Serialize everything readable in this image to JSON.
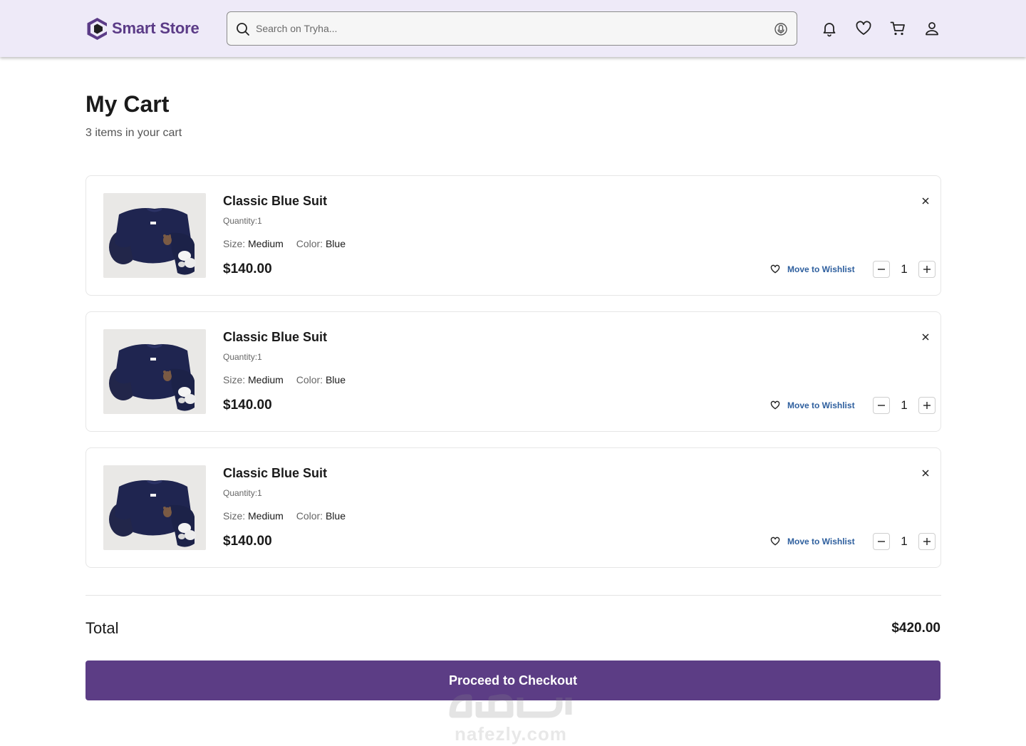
{
  "header": {
    "brand": "Smart Store",
    "search": {
      "placeholder": "Search on Tryha..."
    },
    "icons": [
      "bell-icon",
      "heart-icon",
      "cart-icon",
      "user-icon"
    ]
  },
  "page": {
    "title": "My Cart",
    "subtitle": "3 items in your cart"
  },
  "labels": {
    "size": "Size:",
    "color": "Color:",
    "move_to_wishlist": "Move to Wishlist"
  },
  "cart": {
    "items": [
      {
        "name": "Classic Blue Suit",
        "quantity_text": "Quantity:1",
        "size": "Medium",
        "color": "Blue",
        "price": "$140.00",
        "qty": "1"
      },
      {
        "name": "Classic Blue Suit",
        "quantity_text": "Quantity:1",
        "size": "Medium",
        "color": "Blue",
        "price": "$140.00",
        "qty": "1"
      },
      {
        "name": "Classic Blue Suit",
        "quantity_text": "Quantity:1",
        "size": "Medium",
        "color": "Blue",
        "price": "$140.00",
        "qty": "1"
      }
    ]
  },
  "summary": {
    "total_label": "Total",
    "total_value": "$420.00",
    "checkout_label": "Proceed to Checkout"
  },
  "watermark": {
    "latin": "nafezly.com"
  },
  "colors": {
    "brand": "#5b3b87",
    "button": "#5c3d85",
    "link": "#2e5f9e",
    "header_bg": "#eeeaf8"
  }
}
